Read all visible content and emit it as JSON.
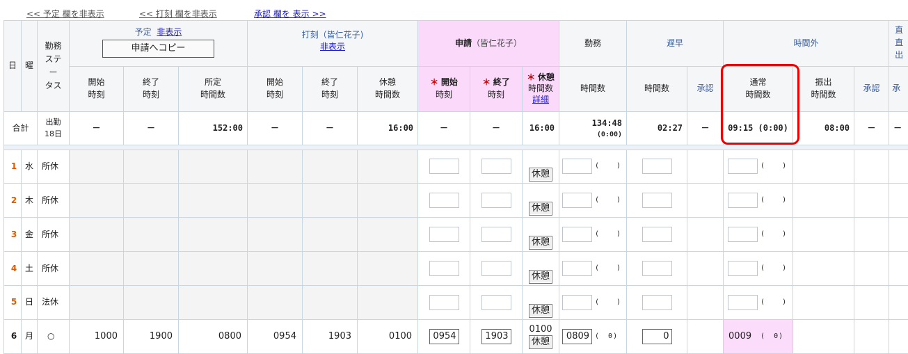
{
  "top_links": {
    "hide_plan": "<< 予定 欄を非表示",
    "hide_punch": "<< 打刻 欄を非表示",
    "show_approval": "承認 欄を 表示 >>"
  },
  "header": {
    "day": "日",
    "weekday": "曜",
    "status_l1": "勤務",
    "status_l2": "ステ",
    "status_l3": "ー",
    "status_l4": "タス",
    "plan_title": "予定",
    "plan_hide": "非表示",
    "copy_button": "申請へコピー",
    "punch_title": "打刻（皆仁花子)",
    "punch_hide": "非表示",
    "request_title": "申請",
    "request_name": "（皆仁花子）",
    "work": "勤務",
    "late_early": "遅早",
    "overtime": "時間外",
    "direct": "直",
    "direct2": "直",
    "direct3": "出",
    "start_l1": "開始",
    "end_l1": "終了",
    "sched_l1": "所定",
    "break_l1": "休憩",
    "time_l2": "時刻",
    "hours_l2": "時間数",
    "req_mark": "＊",
    "req_start": "開始",
    "req_end": "終了",
    "req_break": "休憩",
    "detail": "詳細",
    "hours": "時間数",
    "approve": "承認",
    "normal": "通常",
    "transfer": "振出",
    "approve_short": "承"
  },
  "summary": {
    "label": "合計",
    "attend_l1": "出勤",
    "attend_l2": "18日",
    "dash": "－",
    "plan_sched": "152:00",
    "punch_break": "16:00",
    "req_break": "16:00",
    "work_hours": "134:48",
    "work_sub": "(0:00)",
    "late_hours": "02:27",
    "ot_normal": "09:15 (0:00)",
    "ot_transfer": "08:00",
    "dash_short": "－"
  },
  "rows": [
    {
      "day": "1",
      "wk": "水",
      "status": "所休"
    },
    {
      "day": "2",
      "wk": "木",
      "status": "所休"
    },
    {
      "day": "3",
      "wk": "金",
      "status": "所休"
    },
    {
      "day": "4",
      "wk": "土",
      "status": "所休"
    },
    {
      "day": "5",
      "wk": "日",
      "status": "法休"
    },
    {
      "day": "6",
      "wk": "月",
      "status": "○",
      "p_start": "1000",
      "p_end": "1900",
      "p_sched": "0800",
      "k_start": "0954",
      "k_end": "1903",
      "k_break": "0100",
      "r_start": "0954",
      "r_end": "1903",
      "r_break": "0100",
      "work": "0809",
      "late": "0",
      "ot": "0009"
    }
  ],
  "break_button": "休憩",
  "paren_open": "(",
  "paren_close": ")",
  "paren_zero": "0)"
}
